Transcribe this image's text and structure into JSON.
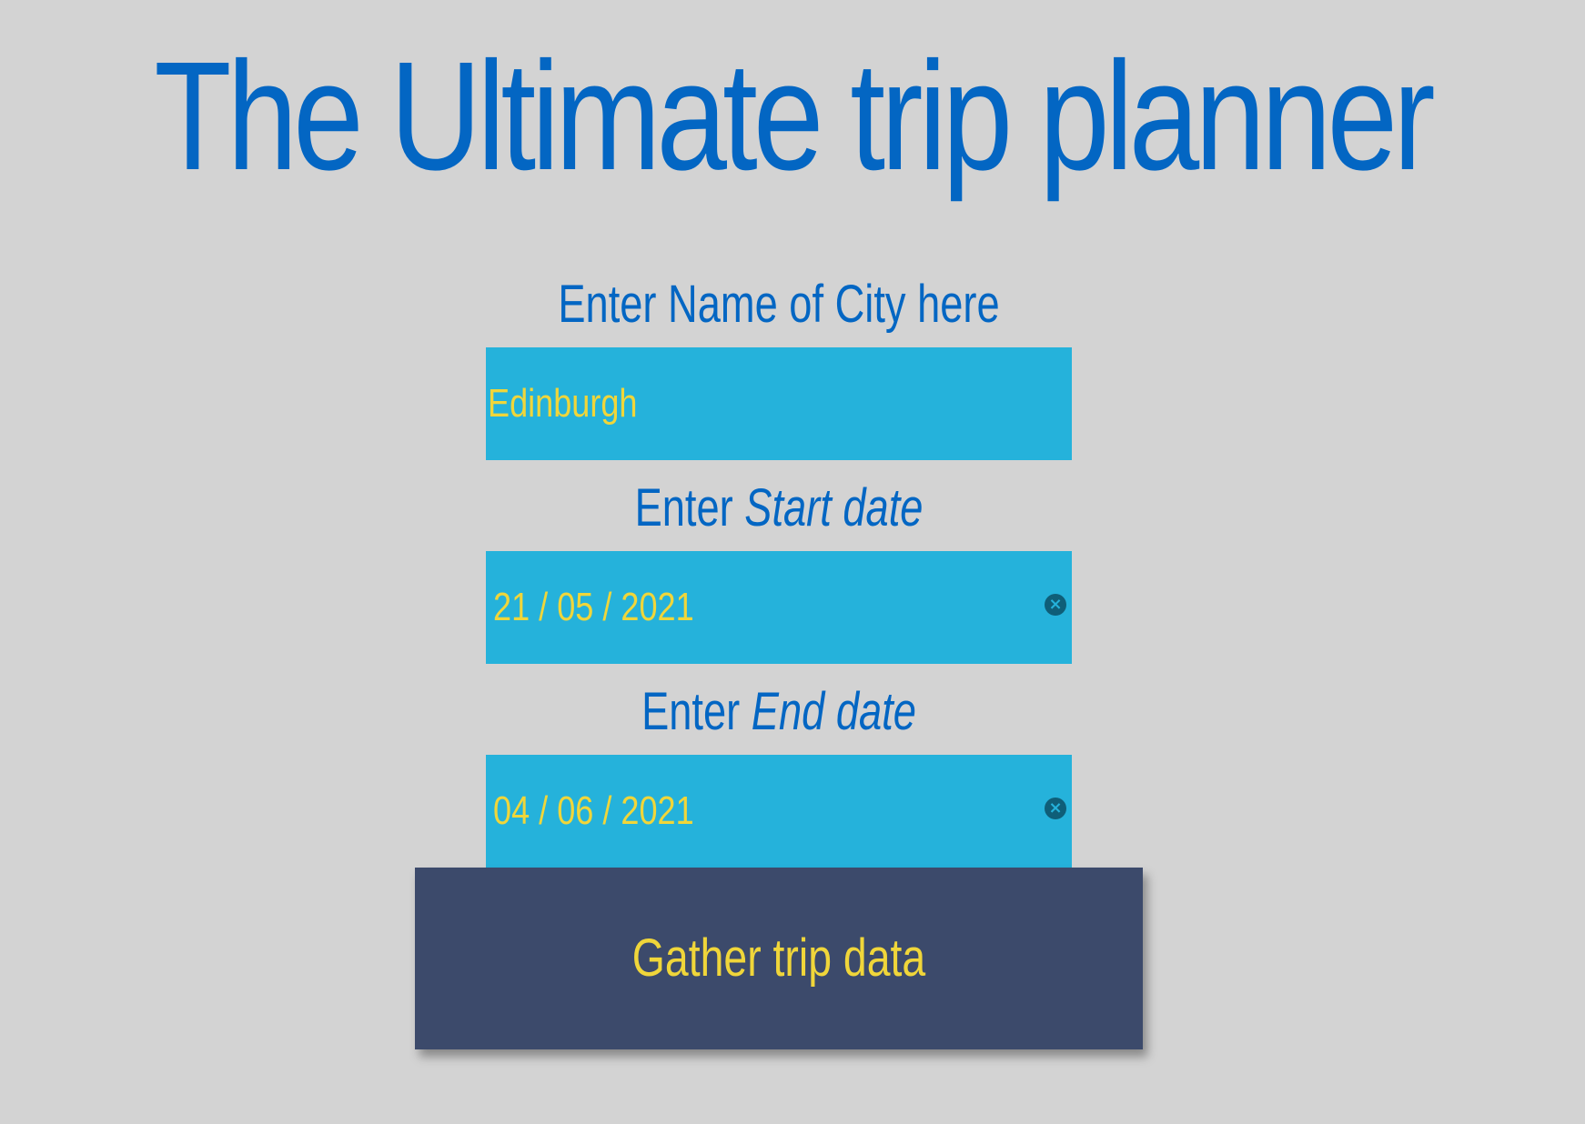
{
  "page": {
    "title": "The Ultimate trip planner"
  },
  "form": {
    "city": {
      "label": "Enter Name of City here",
      "value": "Edinburgh"
    },
    "start_date": {
      "label_prefix": "Enter",
      "label_emphasis": "Start date",
      "value": "21 / 05 / 2021",
      "clear_icon": "clear-icon"
    },
    "end_date": {
      "label_prefix": "Enter",
      "label_emphasis": "End date",
      "value": "04 / 06 / 2021",
      "clear_icon": "clear-icon"
    },
    "submit": {
      "label": "Gather trip data"
    }
  },
  "colors": {
    "background": "#d3d3d3",
    "title_text": "#0366c3",
    "field_background": "#25b2db",
    "field_text": "#f0d63a",
    "button_background": "#3c4a6b",
    "button_text": "#f0d63a"
  }
}
